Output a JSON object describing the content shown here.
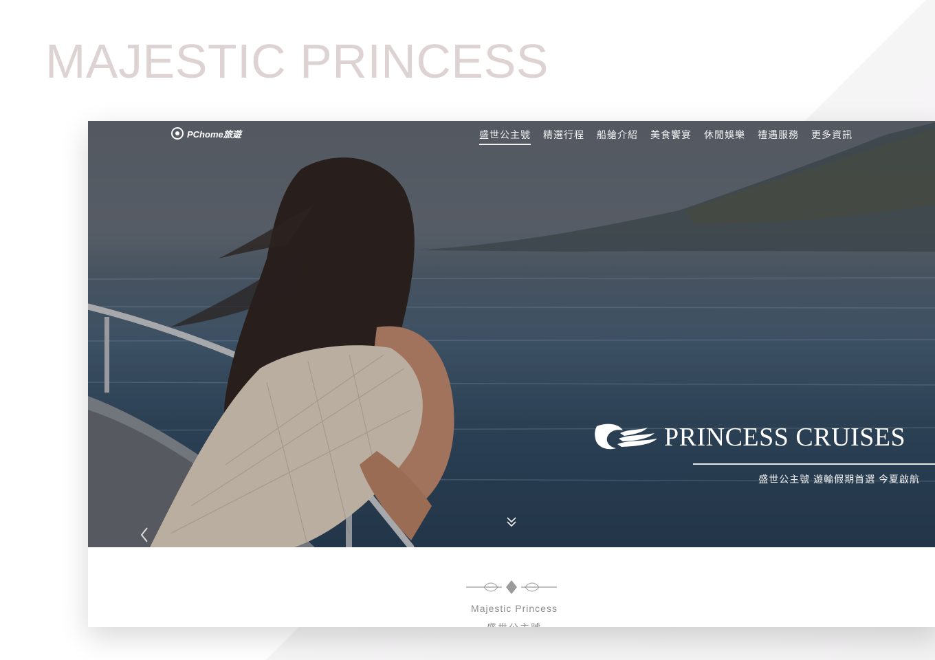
{
  "page": {
    "title": "MAJESTIC PRINCESS"
  },
  "site": {
    "logo_text": "PChome旅遊",
    "nav": [
      {
        "label": "盛世公主號",
        "active": true
      },
      {
        "label": "精選行程",
        "active": false
      },
      {
        "label": "船艙介紹",
        "active": false
      },
      {
        "label": "美食饗宴",
        "active": false
      },
      {
        "label": "休閒娛樂",
        "active": false
      },
      {
        "label": "禮遇服務",
        "active": false
      },
      {
        "label": "更多資訊",
        "active": false
      }
    ]
  },
  "hero": {
    "brand_name": "PRINCESS CRUISES",
    "tagline": "盛世公主號 遊輪假期首選 今夏啟航",
    "icons": [
      "princess-logo-icon",
      "scroll-down-icon",
      "prev-arrow-icon"
    ]
  },
  "section": {
    "title_en": "Majestic Princess",
    "title_zh": "盛世公主號"
  },
  "colors": {
    "showcase_title": "#ddd3d3",
    "nav_text": "#f2f2f2",
    "section_text": "#8c8c8c"
  }
}
